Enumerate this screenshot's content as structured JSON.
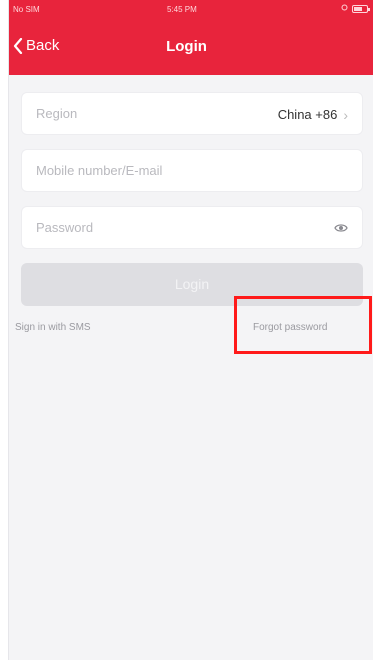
{
  "status_bar": {
    "carrier": "No SIM",
    "time": "5:45 PM"
  },
  "nav": {
    "back_label": "Back",
    "title": "Login"
  },
  "form": {
    "region_label": "Region",
    "region_value": "China +86",
    "account_placeholder": "Mobile number/E-mail",
    "password_placeholder": "Password",
    "login_label": "Login"
  },
  "links": {
    "sms": "Sign in with SMS",
    "forgot": "Forgot password"
  },
  "colors": {
    "header": "#e8243c",
    "highlight": "#ff1a1a"
  }
}
